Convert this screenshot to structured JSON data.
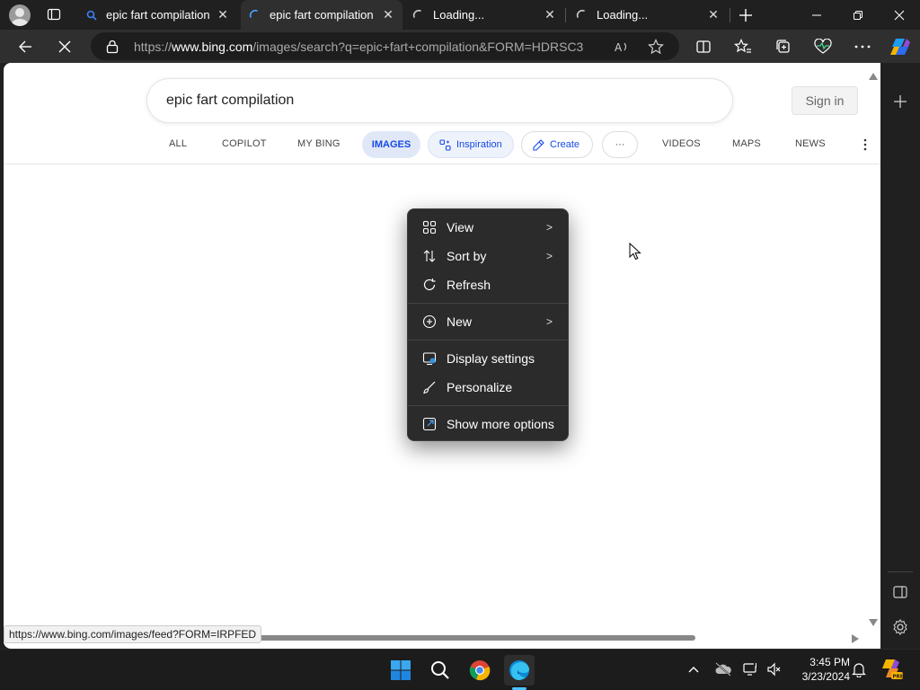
{
  "browser": {
    "tabs": [
      {
        "title": "epic fart compilation",
        "state": "loaded"
      },
      {
        "title": "epic fart compilation",
        "state": "loading",
        "active": true
      },
      {
        "title": "Loading...",
        "state": "loading"
      },
      {
        "title": "Loading...",
        "state": "loading"
      }
    ],
    "url_prefix": "https://",
    "url_host": "www.bing.com",
    "url_path": "/images/search?q=epic+fart+compilation&FORM=HDRSC3"
  },
  "page": {
    "search_query": "epic fart compilation",
    "sign_in": "Sign in",
    "nav": {
      "all": "ALL",
      "copilot": "COPILOT",
      "my_bing": "MY BING",
      "images": "IMAGES",
      "inspiration": "Inspiration",
      "create": "Create",
      "more": "···",
      "videos": "VIDEOS",
      "maps": "MAPS",
      "news": "NEWS"
    },
    "status_url": "https://www.bing.com/images/feed?FORM=IRPFED"
  },
  "context_menu": {
    "items": [
      {
        "label": "View",
        "icon": "grid-icon",
        "submenu": true
      },
      {
        "label": "Sort by",
        "icon": "sort-icon",
        "submenu": true
      },
      {
        "label": "Refresh",
        "icon": "refresh-icon",
        "submenu": false
      },
      {
        "label": "New",
        "icon": "plus-circle-icon",
        "submenu": true
      },
      {
        "label": "Display settings",
        "icon": "display-icon",
        "submenu": false
      },
      {
        "label": "Personalize",
        "icon": "brush-icon",
        "submenu": false
      },
      {
        "label": "Show more options",
        "icon": "open-icon",
        "submenu": false
      }
    ]
  },
  "taskbar": {
    "time": "3:45 PM",
    "date": "3/23/2024"
  },
  "colors": {
    "images_pill": "#e0e8f8",
    "accent_blue": "#174ae4",
    "menu_bg": "#2b2b2b"
  }
}
